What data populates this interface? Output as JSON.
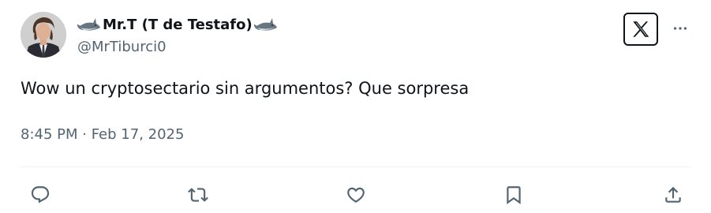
{
  "tweet": {
    "display_name": "Mr.T (T de Testafo)",
    "name_emoji": "shark",
    "handle": "@MrTiburci0",
    "text": "Wow un cryptosectario sin argumentos? Que sorpresa",
    "timestamp": "8:45 PM · Feb 17, 2025"
  },
  "icons": {
    "logo": "x-logo-icon",
    "more": "more-horizontal-icon",
    "actions": [
      "reply-icon",
      "retweet-icon",
      "like-icon",
      "bookmark-icon",
      "share-icon"
    ]
  },
  "colors": {
    "text_primary": "#0f1419",
    "text_secondary": "#536471",
    "icon": "#536471",
    "divider": "#eff3f4"
  }
}
